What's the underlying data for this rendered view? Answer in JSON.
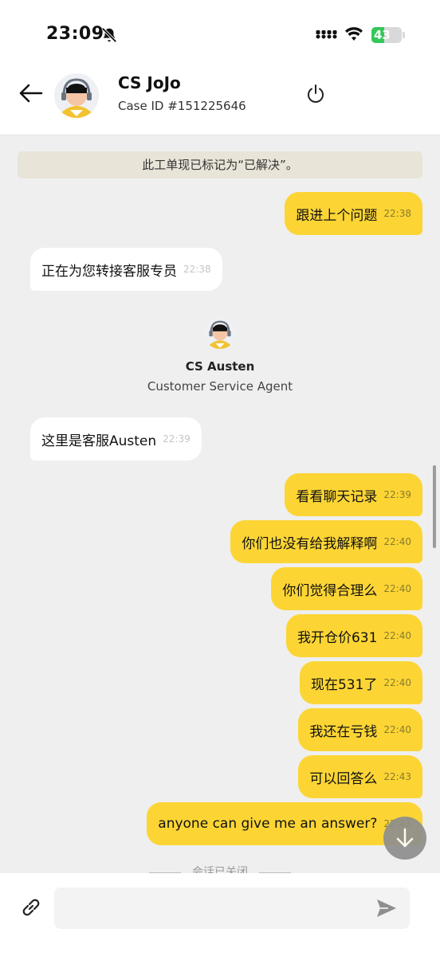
{
  "status_bar": {
    "time": "23:09",
    "battery": "43",
    "battery_level": 0.43
  },
  "header": {
    "agent_name": "CS JoJo",
    "case_id": "Case ID #151225646"
  },
  "system_banner": "此工单现已标记为“已解决”。",
  "messages": [
    {
      "direction": "out",
      "text": "跟进上个问题",
      "time": "22:38"
    },
    {
      "direction": "in",
      "text": "正在为您转接客服专员",
      "time": "22:38"
    },
    {
      "direction": "in",
      "text": "这里是客服Austen",
      "time": "22:39"
    },
    {
      "direction": "out",
      "text": "看看聊天记录",
      "time": "22:39"
    },
    {
      "direction": "out",
      "text": "你们也没有给我解释啊",
      "time": "22:40"
    },
    {
      "direction": "out",
      "text": "你们觉得合理么",
      "time": "22:40"
    },
    {
      "direction": "out",
      "text": "我开仓价631",
      "time": "22:40"
    },
    {
      "direction": "out",
      "text": "现在531了",
      "time": "22:40"
    },
    {
      "direction": "out",
      "text": "我还在亏钱",
      "time": "22:40"
    },
    {
      "direction": "out",
      "text": "可以回答么",
      "time": "22:43"
    },
    {
      "direction": "out",
      "text": "anyone can give me an answer?",
      "time": "22:43"
    }
  ],
  "handoff": {
    "agent_name": "CS Austen",
    "role": "Customer Service Agent"
  },
  "closed_note": "会话已关闭",
  "composer": {
    "placeholder": ""
  },
  "colors": {
    "accent": "#FCD535",
    "background": "#EFEFEF",
    "banner": "#E8E4D8"
  },
  "icons": [
    "bell-slash-icon",
    "signal-icon",
    "wifi-icon",
    "battery-icon",
    "back-arrow-icon",
    "power-icon",
    "link-icon",
    "send-icon",
    "arrow-down-icon"
  ]
}
